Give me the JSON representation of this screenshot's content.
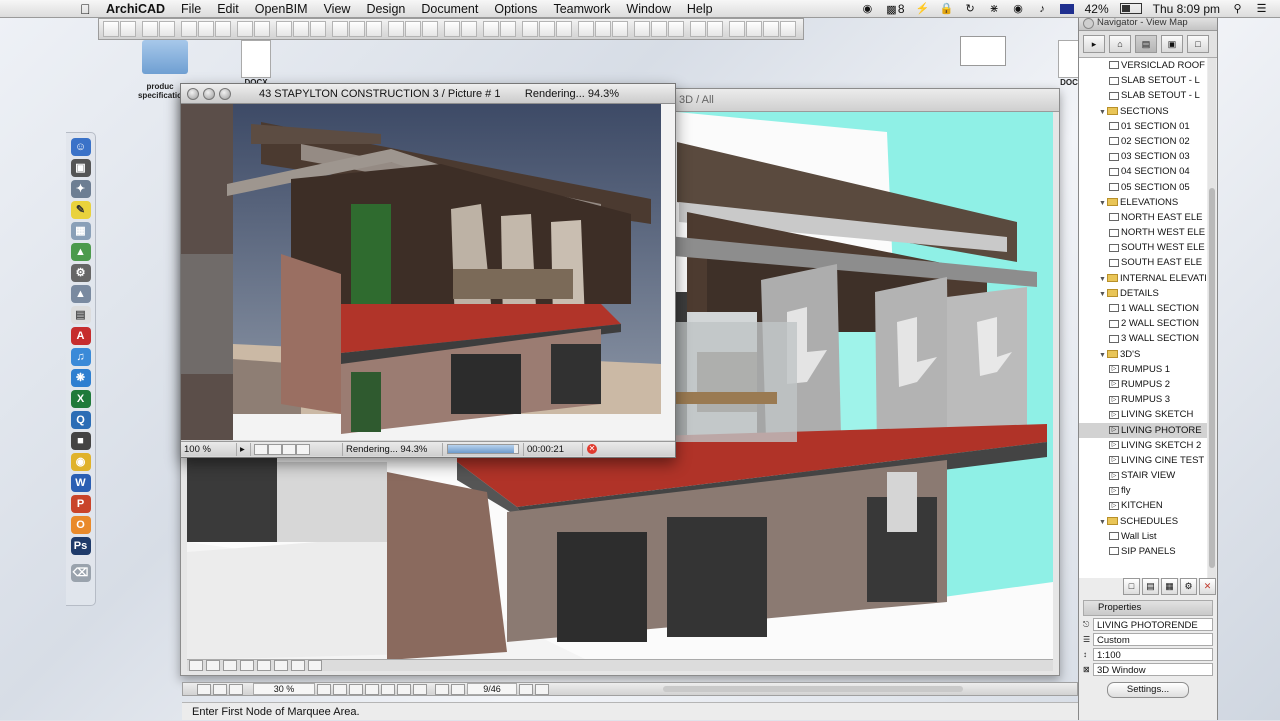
{
  "menubar": {
    "app": "ArchiCAD",
    "items": [
      "File",
      "Edit",
      "OpenBIM",
      "View",
      "Design",
      "Document",
      "Options",
      "Teamwork",
      "Window",
      "Help"
    ],
    "status": {
      "spaces": "8",
      "battery": "42%",
      "clock": "Thu 8:09 pm"
    }
  },
  "desktop": {
    "files": [
      {
        "label": "produc specificatio"
      },
      {
        "label": "DOCX"
      },
      {
        "label": "DOC"
      }
    ]
  },
  "window3d": {
    "title": "3D / All"
  },
  "picture_window": {
    "title": "43 STAPYLTON CONSTRUCTION 3 / Picture # 1        Rendering... 94.3%",
    "zoom": "100 %",
    "status": "Rendering... 94.3%",
    "progress": 0.943,
    "elapsed": "00:00:21"
  },
  "navbar": {
    "zoom": "30 %",
    "page": "9/46"
  },
  "statusbar": {
    "message": "Enter First Node of Marquee Area."
  },
  "navigator": {
    "title": "Navigator - View Map",
    "tree": [
      {
        "label": "VERSICLAD ROOF",
        "type": "item",
        "indent": 2
      },
      {
        "label": "SLAB SETOUT - L",
        "type": "item",
        "indent": 2
      },
      {
        "label": "SLAB SETOUT - L",
        "type": "item",
        "indent": 2
      },
      {
        "label": "SECTIONS",
        "type": "folder",
        "indent": 1
      },
      {
        "label": "01 SECTION 01",
        "type": "item",
        "indent": 2
      },
      {
        "label": "02 SECTION 02",
        "type": "item",
        "indent": 2
      },
      {
        "label": "03 SECTION 03",
        "type": "item",
        "indent": 2
      },
      {
        "label": "04 SECTION 04",
        "type": "item",
        "indent": 2
      },
      {
        "label": "05 SECTION 05",
        "type": "item",
        "indent": 2
      },
      {
        "label": "ELEVATIONS",
        "type": "folder",
        "indent": 1
      },
      {
        "label": "NORTH EAST ELE",
        "type": "item",
        "indent": 2
      },
      {
        "label": "NORTH WEST ELE",
        "type": "item",
        "indent": 2
      },
      {
        "label": "SOUTH WEST ELE",
        "type": "item",
        "indent": 2
      },
      {
        "label": "SOUTH EAST ELE",
        "type": "item",
        "indent": 2
      },
      {
        "label": "INTERNAL ELEVATIO",
        "type": "folder",
        "indent": 1
      },
      {
        "label": "DETAILS",
        "type": "folder",
        "indent": 1
      },
      {
        "label": "1 WALL SECTION",
        "type": "item",
        "indent": 2
      },
      {
        "label": "2 WALL SECTION",
        "type": "item",
        "indent": 2
      },
      {
        "label": "3 WALL SECTION",
        "type": "item",
        "indent": 2
      },
      {
        "label": "3D'S",
        "type": "folder",
        "indent": 1
      },
      {
        "label": "RUMPUS 1",
        "type": "cam",
        "indent": 2
      },
      {
        "label": "RUMPUS 2",
        "type": "cam",
        "indent": 2
      },
      {
        "label": "RUMPUS 3",
        "type": "cam",
        "indent": 2
      },
      {
        "label": "LIVING SKETCH",
        "type": "cam",
        "indent": 2
      },
      {
        "label": "LIVING PHOTORE",
        "type": "cam",
        "indent": 2,
        "selected": true
      },
      {
        "label": "LIVING SKETCH 2",
        "type": "cam",
        "indent": 2
      },
      {
        "label": "LIVING CINE TEST",
        "type": "cam",
        "indent": 2
      },
      {
        "label": "STAIR VIEW",
        "type": "cam",
        "indent": 2
      },
      {
        "label": "fly",
        "type": "cam",
        "indent": 2
      },
      {
        "label": "KITCHEN",
        "type": "cam",
        "indent": 2
      },
      {
        "label": "SCHEDULES",
        "type": "folder",
        "indent": 1
      },
      {
        "label": "Wall List",
        "type": "item",
        "indent": 2
      },
      {
        "label": "SIP PANELS",
        "type": "item",
        "indent": 2
      }
    ],
    "properties": {
      "header": "Properties",
      "name": "LIVING PHOTORENDE",
      "fields": [
        "Custom",
        "1:100",
        "3D Window"
      ],
      "settings_label": "Settings..."
    }
  }
}
